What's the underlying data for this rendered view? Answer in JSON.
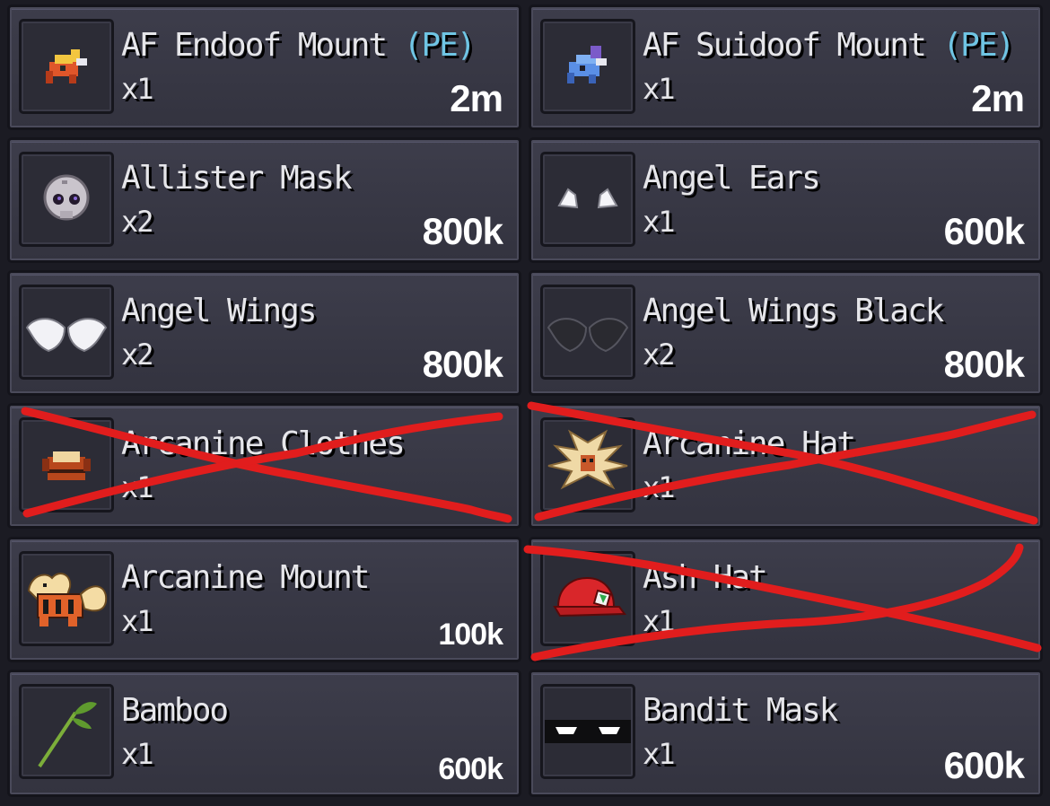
{
  "items": [
    {
      "name": "AF Endoof Mount",
      "tag": "(PE)",
      "qty": "x1",
      "price": "2m",
      "icon": "endoof-mount-icon",
      "crossed": false
    },
    {
      "name": "AF Suidoof Mount",
      "tag": "(PE)",
      "qty": "x1",
      "price": "2m",
      "icon": "suidoof-mount-icon",
      "crossed": false
    },
    {
      "name": "Allister Mask",
      "tag": "",
      "qty": "x2",
      "price": "800k",
      "icon": "allister-mask-icon",
      "crossed": false
    },
    {
      "name": "Angel Ears",
      "tag": "",
      "qty": "x1",
      "price": "600k",
      "icon": "angel-ears-icon",
      "crossed": false
    },
    {
      "name": "Angel Wings",
      "tag": "",
      "qty": "x2",
      "price": "800k",
      "icon": "angel-wings-icon",
      "crossed": false
    },
    {
      "name": "Angel Wings Black",
      "tag": "",
      "qty": "x2",
      "price": "800k",
      "icon": "angel-wings-black-icon",
      "crossed": false
    },
    {
      "name": "Arcanine Clothes",
      "tag": "",
      "qty": "x1",
      "price": "",
      "icon": "arcanine-clothes-icon",
      "crossed": true
    },
    {
      "name": "Arcanine Hat",
      "tag": "",
      "qty": "x1",
      "price": "",
      "icon": "arcanine-hat-icon",
      "crossed": true
    },
    {
      "name": "Arcanine Mount",
      "tag": "",
      "qty": "x1",
      "price": "100k",
      "icon": "arcanine-mount-icon",
      "crossed": false
    },
    {
      "name": "Ash Hat",
      "tag": "",
      "qty": "x1",
      "price": "",
      "icon": "ash-hat-icon",
      "crossed": true
    },
    {
      "name": "Bamboo",
      "tag": "",
      "qty": "x1",
      "price": "600k",
      "icon": "bamboo-icon",
      "crossed": false
    },
    {
      "name": "Bandit Mask",
      "tag": "",
      "qty": "x1",
      "price": "600k",
      "icon": "bandit-mask-icon",
      "crossed": false
    }
  ],
  "colors": {
    "background": "#1b1b23",
    "card": "#3a3a47",
    "pe_tag": "#6fc5e4",
    "scribble": "#e11d1d"
  }
}
